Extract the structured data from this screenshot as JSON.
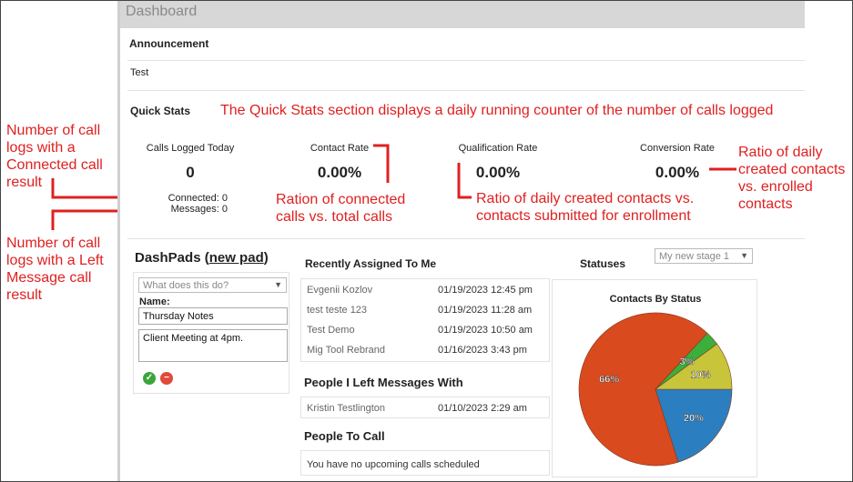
{
  "header": {
    "title": "Dashboard"
  },
  "announcement": {
    "title": "Announcement",
    "text": "Test"
  },
  "quick_stats": {
    "title": "Quick Stats",
    "stats": [
      {
        "label": "Calls Logged Today",
        "value": "0"
      },
      {
        "label": "Contact Rate",
        "value": "0.00%"
      },
      {
        "label": "Qualification Rate",
        "value": "0.00%"
      },
      {
        "label": "Conversion Rate",
        "value": "0.00%"
      }
    ],
    "connected": "Connected: 0",
    "messages": "Messages: 0"
  },
  "annotations": {
    "quick_stats_note": "The Quick Stats section displays a daily running counter of the number of calls logged",
    "connected_note": "Number of call logs with a Connected call result",
    "message_note": "Number of call logs with a Left Message call result",
    "contact_rate_note": "Ration of connected calls vs. total calls",
    "qualification_note": "Ratio of daily created contacts vs. contacts submitted for enrollment",
    "conversion_note": "Ratio of daily created contacts vs. enrolled contacts"
  },
  "dashpads": {
    "title": "DashPads",
    "new_pad": "new pad",
    "open_paren": "(",
    "close_paren": ")",
    "select_placeholder": "What does this do?",
    "name_label": "Name:",
    "name_value": "Thursday Notes",
    "note_value": "Client Meeting at 4pm."
  },
  "recent": {
    "title": "Recently Assigned To Me",
    "rows": [
      {
        "name": "Evgenii Kozlov",
        "date": "01/19/2023 12:45 pm"
      },
      {
        "name": "test teste 123",
        "date": "01/19/2023 11:28 am"
      },
      {
        "name": "Test Demo",
        "date": "01/19/2023 10:50 am"
      },
      {
        "name": "Mig Tool Rebrand",
        "date": "01/16/2023 3:43 pm"
      }
    ]
  },
  "messages_section": {
    "title": "People I Left Messages With",
    "rows": [
      {
        "name": "Kristin Testlington",
        "date": "01/10/2023 2:29 am"
      }
    ]
  },
  "to_call": {
    "title": "People To Call",
    "empty": "You have no upcoming calls scheduled"
  },
  "statuses": {
    "title": "Statuses",
    "stage_select": "My new stage 1"
  },
  "chart_data": {
    "type": "pie",
    "title": "Contacts By Status",
    "slices": [
      {
        "label": "66%",
        "value": 66,
        "color": "#d94a1e"
      },
      {
        "label": "20%",
        "value": 20,
        "color": "#2b7fc0"
      },
      {
        "label": "10%",
        "value": 10,
        "color": "#c9c53a"
      },
      {
        "label": "3%",
        "value": 3,
        "color": "#3cae3c"
      }
    ]
  }
}
